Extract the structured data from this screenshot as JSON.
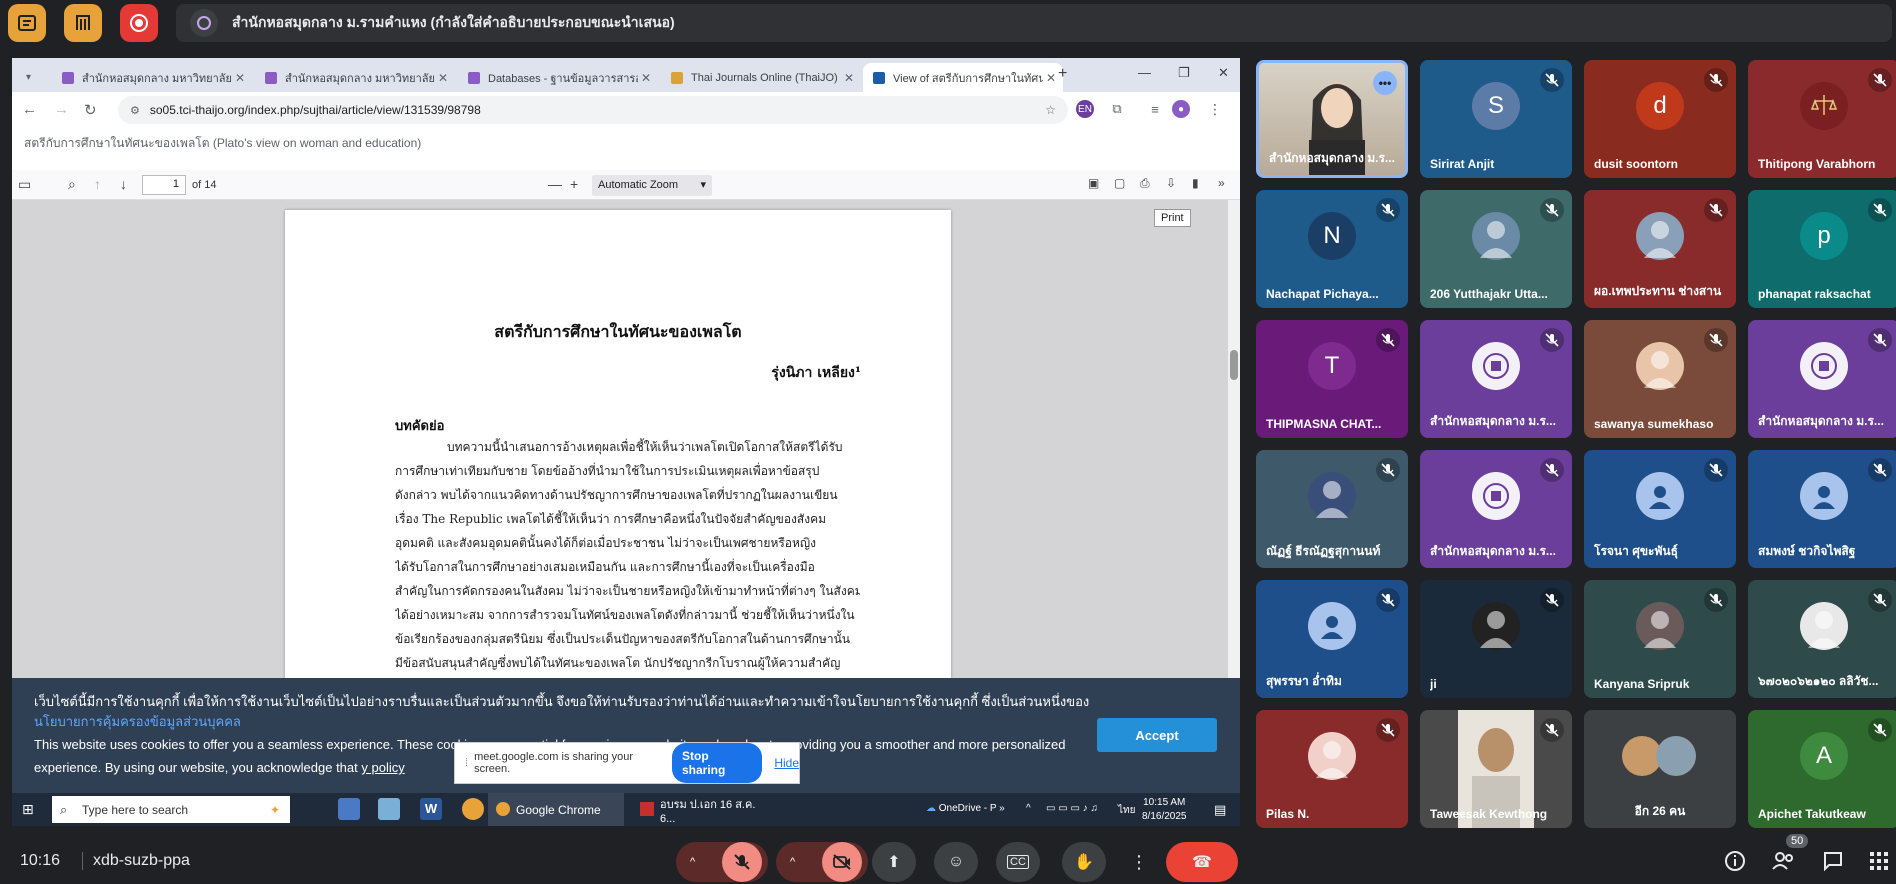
{
  "meet": {
    "presenting_title": "สำนักหอสมุดกลาง ม.รามคำแหง (กำลังใส่คำอธิบายประกอบขณะนำเสนอ)",
    "time": "10:16",
    "meeting_code": "xdb-suzb-ppa",
    "participants_badge": "50",
    "tooltip": "Print"
  },
  "browser": {
    "tabs": [
      {
        "label": "สำนักหอสมุดกลาง มหาวิทยาลัยราม",
        "fav": "#8a5cc4"
      },
      {
        "label": "สำนักหอสมุดกลาง มหาวิทยาลัยราม",
        "fav": "#8a5cc4"
      },
      {
        "label": "Databases - ฐานข้อมูลวารสารออนไลน์",
        "fav": "#8a5cc4"
      },
      {
        "label": "Thai Journals Online (ThaiJO)",
        "fav": "#d7a33a"
      },
      {
        "label": "View of สตรีกับการศึกษาในทัศนะของเพลโต",
        "fav": "#1a5ea8"
      }
    ],
    "url": "so05.tci-thaijo.org/index.php/sujthai/article/view/131539/98798",
    "pdf_doc_title": "สตรีกับการศึกษาในทัศนะของเพลโต (Plato's view on woman and education)"
  },
  "pdf": {
    "page_number": "1",
    "page_count": "of 14",
    "zoom": "Automatic Zoom",
    "title": "สตรีกับการศึกษาในทัศนะของเพลโต",
    "author": "รุ่งนิภา เหลียง¹",
    "abstract_heading": "บทคัดย่อ",
    "lines": [
      "บทความนี้นำเสนอการอ้างเหตุผลเพื่อชี้ให้เห็นว่าเพลโตเปิดโอกาสให้สตรีได้รับ",
      "การศึกษาเท่าเทียมกับชาย โดยข้ออ้างที่นำมาใช้ในการประเมินเหตุผลเพื่อหาข้อสรุป",
      "ดังกล่าว พบได้จากแนวคิดทางด้านปรัชญาการศึกษาของเพลโตที่ปรากฏในผลงานเขียน",
      "เรื่อง The Republic เพลโตได้ชี้ให้เห็นว่า การศึกษาคือหนึ่งในปัจจัยสำคัญของสังคม",
      "อุดมคติ และสังคมอุดมคตินั้นคงได้ก็ต่อเมื่อประชาชน ไม่ว่าจะเป็นเพศชายหรือหญิง",
      "ได้รับโอกาสในการศึกษาอย่างเสมอเหมือนกัน และการศึกษานี้เองที่จะเป็นเครื่องมือ",
      "สำคัญในการคัดกรองคนในสังคม ไม่ว่าจะเป็นชายหรือหญิงให้เข้ามาทำหน้าที่ต่างๆ ในสังคม",
      "ได้อย่างเหมาะสม จากการสำรวจมโนทัศน์ของเพลโตดังที่กล่าวมานี้ ช่วยชี้ให้เห็นว่าหนึ่งใน",
      "ข้อเรียกร้องของกลุ่มสตรีนิยม ซึ่งเป็นประเด็นปัญหาของสตรีกับโอกาสในด้านการศึกษานั้น",
      "มีข้อสนับสนุนสำคัญซึ่งพบได้ในทัศนะของเพลโต นักปรัชญากรีกโบราณผู้ให้ความสำคัญ"
    ]
  },
  "cookie": {
    "thai_text": "เว็บไซต์นี้มีการใช้งานคุกกี้ เพื่อให้การใช้งานเว็บไซต์เป็นไปอย่างราบรื่นและเป็นส่วนตัวมากขึ้น จึงขอให้ท่านรับรองว่าท่านได้อ่านและทำความเข้าใจนโยบายการใช้งานคุกกี้ ซึ่งเป็นส่วนหนึ่งของ",
    "thai_link": "นโยบายการคุ้มครองข้อมูลส่วนบุคคล",
    "en_text": "This website uses cookies to offer you a seamless experience. These cookies are essential for running our website and are key to providing you a smoother and more personalized experience. By using our website, you acknowledge that",
    "en_link": "y policy",
    "accept": "Accept"
  },
  "sharebar": {
    "text": "meet.google.com is sharing your screen.",
    "stop": "Stop sharing",
    "hide": "Hide"
  },
  "taskbar": {
    "search": "Type here to search",
    "chrome": "Google Chrome",
    "doc": "อบรม ป.เอก 16 ส.ค. 6...",
    "onedrive": "OneDrive - P",
    "lang": "ไทย",
    "clock_time": "10:15 AM",
    "clock_date": "8/16/2025"
  },
  "participants": [
    {
      "name": "สำนักหอสมุดกลาง ม.ร...",
      "bg": "#c9c1b4",
      "kind": "video",
      "speaking": true
    },
    {
      "name": "Sirirat Anjit",
      "bg": "#1e5a8a",
      "kind": "letter",
      "letter": "S",
      "avatar": "#5c7ba6"
    },
    {
      "name": "dusit soontorn",
      "bg": "#8a2b1f",
      "kind": "letter",
      "letter": "d",
      "avatar": "#c0391b"
    },
    {
      "name": "Thitipong Varabhorn",
      "bg": "#8b2a2d",
      "kind": "logo",
      "avatar": "#7a1f22"
    },
    {
      "name": "Nachapat Pichaya...",
      "bg": "#1e5a8a",
      "kind": "letter",
      "letter": "N",
      "avatar": "#1a3e66"
    },
    {
      "name": "206 Yutthajakr Utta...",
      "bg": "#3e6a6a",
      "kind": "photo",
      "avatar": "#6b8aa6"
    },
    {
      "name": "ผอ.เทพประทาน ช่างสาน",
      "bg": "#8a2b2b",
      "kind": "photo",
      "avatar": "#8aa0b8"
    },
    {
      "name": "phanapat raksachat",
      "bg": "#0f6c6c",
      "kind": "letter",
      "letter": "p",
      "avatar": "#0b8a8a"
    },
    {
      "name": "THIPMASNA CHAT...",
      "bg": "#6a1b7a",
      "kind": "letter",
      "letter": "T",
      "avatar": "#7e2a8e"
    },
    {
      "name": "สำนักหอสมุดกลาง ม.ร...",
      "bg": "#6a3e9a",
      "kind": "emblem",
      "avatar": "#f4f0f8"
    },
    {
      "name": "sawanya sumekhaso",
      "bg": "#7a4a3a",
      "kind": "photo",
      "avatar": "#e8c4a8"
    },
    {
      "name": "สำนักหอสมุดกลาง ม.ร...",
      "bg": "#6a3e9a",
      "kind": "emblem",
      "avatar": "#f4f0f8"
    },
    {
      "name": "ณัฏฐ์ ธีรณัฏฐสุกานนท์",
      "bg": "#3e5a6a",
      "kind": "photo",
      "avatar": "#3a4e7a"
    },
    {
      "name": "สำนักหอสมุดกลาง ม.ร...",
      "bg": "#6a3e9a",
      "kind": "emblem",
      "avatar": "#f4f0f8"
    },
    {
      "name": "โรจนา ศุขะพันธุ์",
      "bg": "#1e4f8a",
      "kind": "person",
      "avatar": "#a8c4ec"
    },
    {
      "name": "สมพงษ์ ชวกิจไพสิฐ",
      "bg": "#1e4f8a",
      "kind": "person",
      "avatar": "#a8c4ec"
    },
    {
      "name": "สุพรรษา อ่ำทิม",
      "bg": "#1e4f8a",
      "kind": "person",
      "avatar": "#a8c4ec"
    },
    {
      "name": "ji",
      "bg": "#1a2a3a",
      "kind": "photo",
      "avatar": "#222"
    },
    {
      "name": "Kanyana Sripruk",
      "bg": "#2e4a4a",
      "kind": "photo",
      "avatar": "#6a5a5a"
    },
    {
      "name": "๖๗๐๒๐๖๒๑๒๐ ลลิวัช...",
      "bg": "#2e4a4a",
      "kind": "photo",
      "avatar": "#e8e8e8"
    },
    {
      "name": "Pilas N.",
      "bg": "#8a2b2b",
      "kind": "photo",
      "avatar": "#f0d0c8"
    },
    {
      "name": "Taweesak Kewthong",
      "bg": "#4a4a4a",
      "kind": "video2",
      "avatar": "#b89a80"
    },
    {
      "name": "อีก 26 คน",
      "bg": "#3c4043",
      "kind": "more",
      "avatar": "#8a6a50"
    },
    {
      "name": "Apichet Takutkeaw",
      "bg": "#2e6a2e",
      "kind": "letter",
      "letter": "A",
      "avatar": "#3e8a3e"
    }
  ]
}
